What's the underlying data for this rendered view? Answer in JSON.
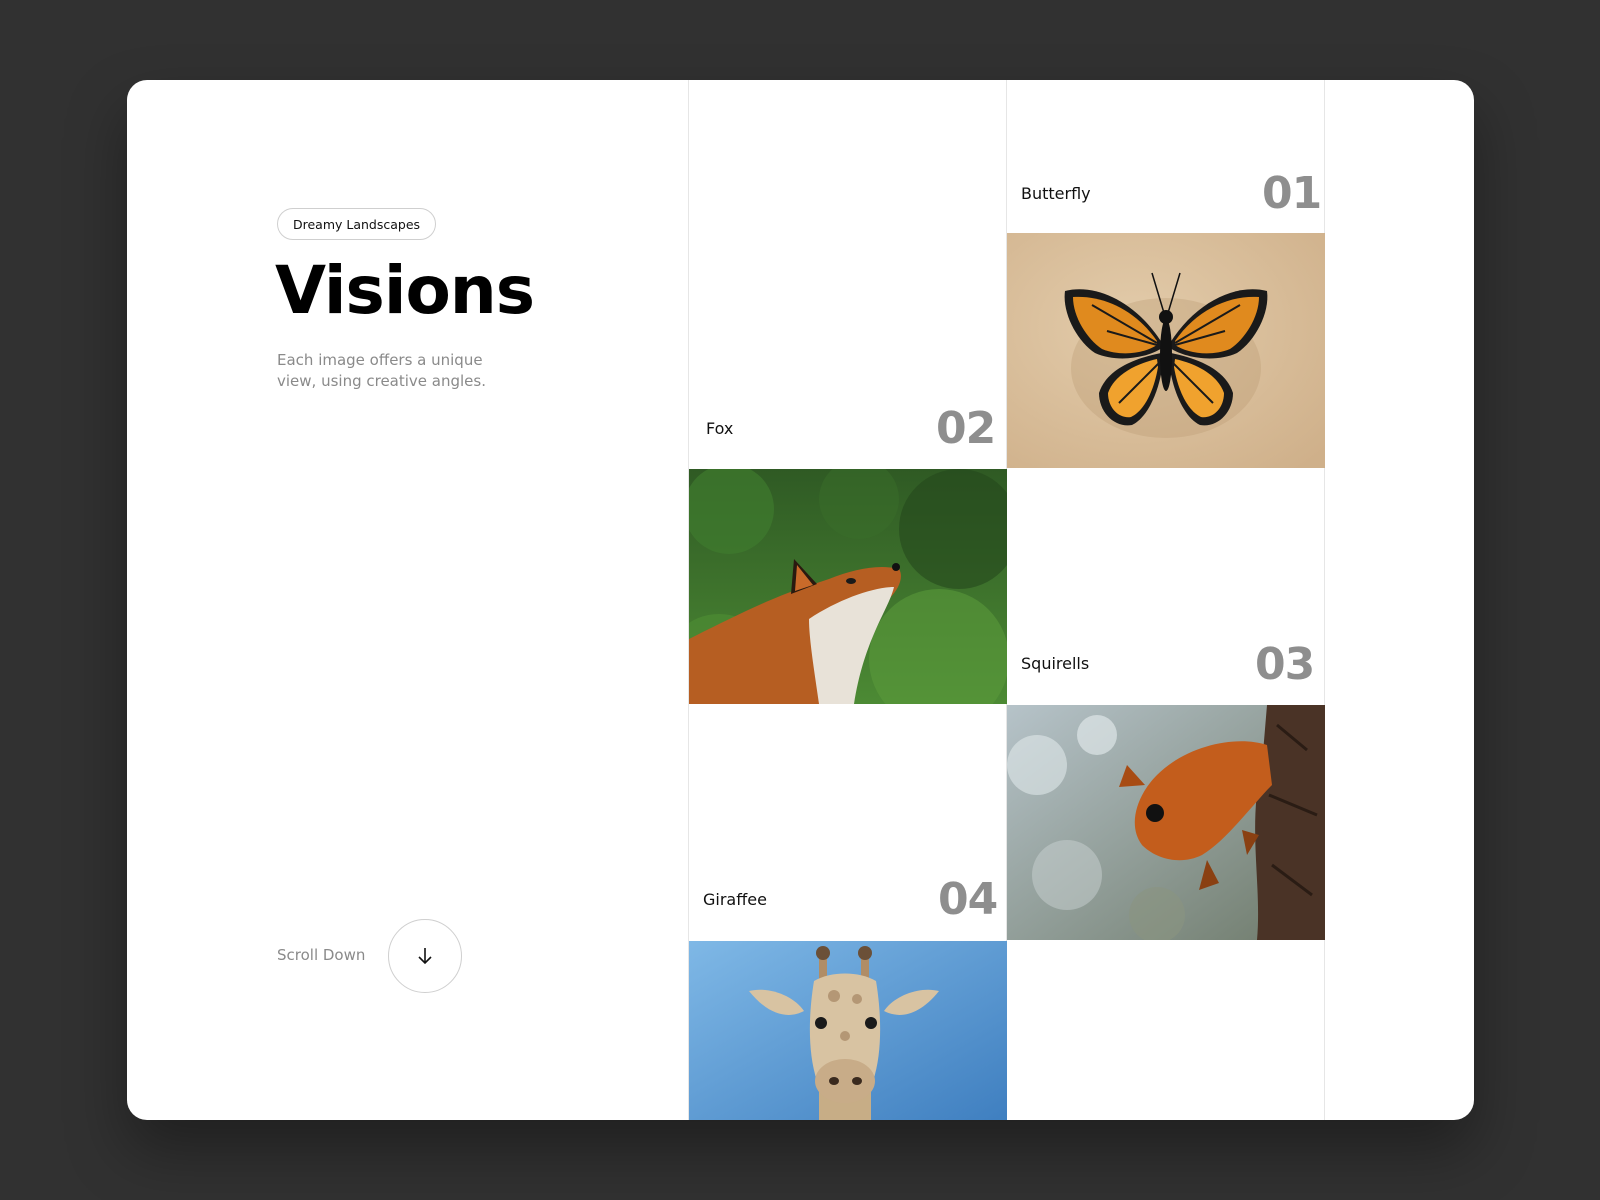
{
  "hero": {
    "tag": "Dreamy Landscapes",
    "title": "Visions",
    "description": "Each image offers a unique view, using creative angles."
  },
  "scroll": {
    "label": "Scroll Down",
    "icon": "arrow-down-icon"
  },
  "gallery": [
    {
      "number": "01",
      "name": "Butterfly"
    },
    {
      "number": "02",
      "name": "Fox"
    },
    {
      "number": "03",
      "name": "Squirells"
    },
    {
      "number": "04",
      "name": "Giraffee"
    }
  ],
  "colors": {
    "background": "#313131",
    "card": "#ffffff",
    "number": "#8e8e8e",
    "muted_text": "#8a8a8a"
  }
}
